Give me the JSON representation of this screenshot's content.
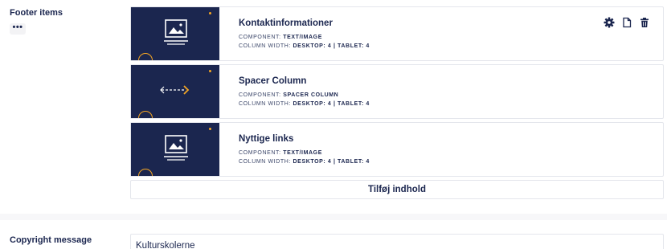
{
  "footer_section": {
    "label": "Footer items",
    "more_label": "•••",
    "blocks": [
      {
        "title": "Kontaktinformationer",
        "component_prefix": "COMPONENT:",
        "component": "TEXT/IMAGE",
        "width_prefix": "COLUMN WIDTH:",
        "width": "DESKTOP: 4 | TABLET: 4",
        "thumbnail_icon": "image-icon",
        "show_actions": true
      },
      {
        "title": "Spacer Column",
        "component_prefix": "COMPONENT:",
        "component": "SPACER COLUMN",
        "width_prefix": "COLUMN WIDTH:",
        "width": "DESKTOP: 4 | TABLET: 4",
        "thumbnail_icon": "arrow-right-icon",
        "show_actions": false
      },
      {
        "title": "Nyttige links",
        "component_prefix": "COMPONENT:",
        "component": "TEXT/IMAGE",
        "width_prefix": "COLUMN WIDTH:",
        "width": "DESKTOP: 4 | TABLET: 4",
        "thumbnail_icon": "image-icon",
        "show_actions": false
      }
    ],
    "actions": [
      "gear-icon",
      "copy-icon",
      "trash-icon"
    ],
    "add_label": "Tilføj indhold"
  },
  "copyright_section": {
    "label": "Copyright message",
    "value": "Kulturskolerne"
  },
  "colors": {
    "thumbnail_bg": "#1b264f",
    "accent": "#f5a623",
    "text": "#1b264f",
    "border": "#e4e6ec"
  }
}
